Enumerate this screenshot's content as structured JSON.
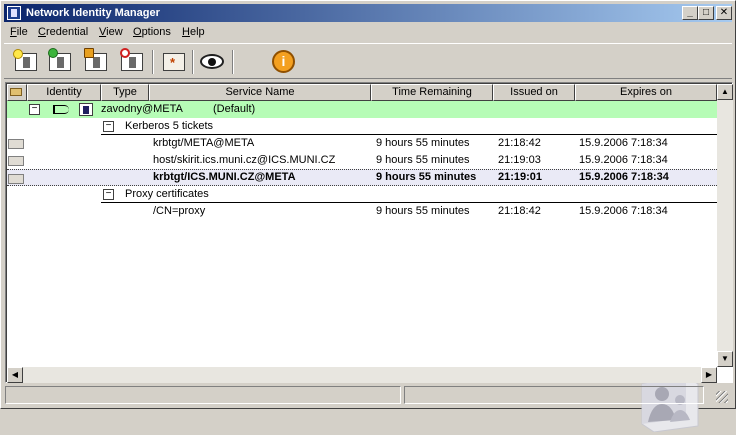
{
  "window": {
    "title": "Network Identity Manager"
  },
  "menu": {
    "items": [
      {
        "label": "File",
        "u": "F",
        "rest": "ile"
      },
      {
        "label": "Credential",
        "u": "C",
        "rest": "redential"
      },
      {
        "label": "View",
        "u": "V",
        "rest": "iew"
      },
      {
        "label": "Options",
        "u": "O",
        "rest": "ptions"
      },
      {
        "label": "Help",
        "u": "H",
        "rest": "elp"
      }
    ]
  },
  "toolbar": {
    "buttons": [
      "new-credentials",
      "renew-credentials",
      "import-credentials",
      "destroy-credentials",
      "change-password",
      "show-passwords",
      "about"
    ]
  },
  "columns": [
    "Identity",
    "Type",
    "Service Name",
    "Time Remaining",
    "Issued on",
    "Expires on"
  ],
  "identity": {
    "name": "zavodny@META",
    "tag": "(Default)",
    "expander": "−",
    "highlight": "#b6fcb6"
  },
  "groups": [
    {
      "label": "Kerberos 5 tickets",
      "expander": "−",
      "rows": [
        {
          "service": "krbtgt/META@META",
          "remaining": "9 hours 55 minutes",
          "issued": "21:18:42",
          "expires": "15.9.2006 7:18:34",
          "bold": false
        },
        {
          "service": "host/skirit.ics.muni.cz@ICS.MUNI.CZ",
          "remaining": "9 hours 55 minutes",
          "issued": "21:19:03",
          "expires": "15.9.2006 7:18:34",
          "bold": false
        },
        {
          "service": "krbtgt/ICS.MUNI.CZ@META",
          "remaining": "9 hours 55 minutes",
          "issued": "21:19:01",
          "expires": "15.9.2006 7:18:34",
          "bold": true
        }
      ]
    },
    {
      "label": "Proxy certificates",
      "expander": "−",
      "rows": [
        {
          "service": "/CN=proxy",
          "remaining": "9 hours 55 minutes",
          "issued": "21:18:42",
          "expires": "15.9.2006 7:18:34",
          "bold": false
        }
      ]
    }
  ],
  "caption": {
    "minimize": "_",
    "maximize": "□",
    "close": "✕"
  },
  "scroll": {
    "up": "▲",
    "down": "▼",
    "left": "◀",
    "right": "▶"
  }
}
